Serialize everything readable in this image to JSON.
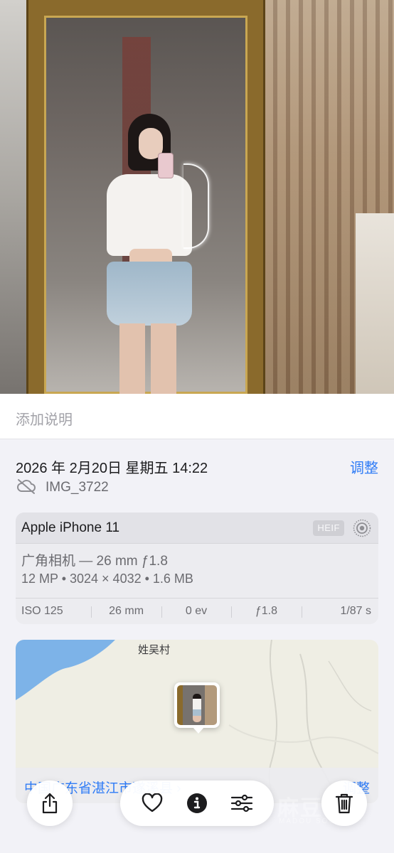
{
  "photo": {
    "description_icon": "photo-mirror-selfie"
  },
  "caption": {
    "placeholder": "添加说明"
  },
  "info": {
    "date": "2026 年 2月20日 星期五 14:22",
    "adjust_label": "调整",
    "filename": "IMG_3722",
    "cloud_icon": "cloud-slash-icon"
  },
  "exif": {
    "model": "Apple iPhone 11",
    "format_badge": "HEIF",
    "lens": "广角相机 — 26 mm ƒ1.8",
    "spec": "12 MP • 3024 × 4032 • 1.6 MB",
    "stats": [
      "ISO 125",
      "26 mm",
      "0 ev",
      "ƒ1.8",
      "1/87 s"
    ]
  },
  "map": {
    "place_label": "姓吴村",
    "address": "中国广东省湛江市遂溪县 ›",
    "adjust_label": "调整"
  },
  "toolbar": {
    "share": "share-icon",
    "favorite": "heart-icon",
    "info": "info-icon",
    "edit": "sliders-icon",
    "delete": "trash-icon"
  },
  "watermark": {
    "main": "麻豆社",
    "sub": "MADOU SOCIAL"
  },
  "colors": {
    "accent": "#2f7cf6",
    "background": "#f2f2f7",
    "secondary_text": "#6b6b70"
  }
}
